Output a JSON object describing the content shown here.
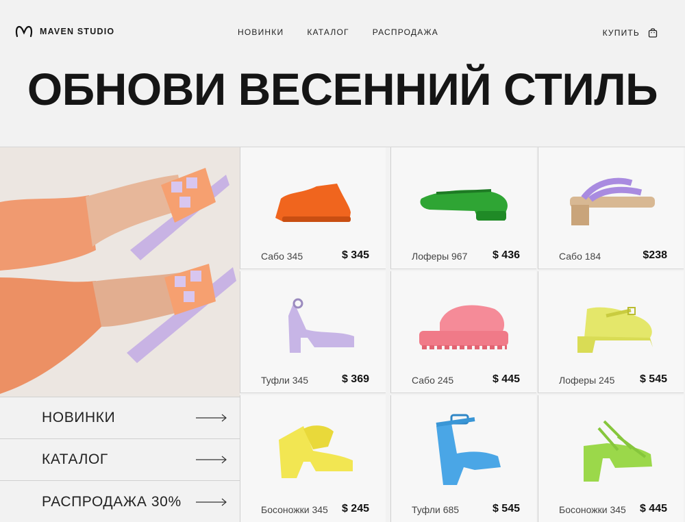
{
  "brand": {
    "name": "MAVEN STUDIO",
    "logo_icon": "infinity-loop-icon"
  },
  "nav": {
    "items": [
      {
        "label": "НОВИНКИ"
      },
      {
        "label": "КАТАЛОГ"
      },
      {
        "label": "РАСПРОДАЖА"
      }
    ]
  },
  "cart": {
    "label": "КУПИТЬ",
    "icon": "shopping-bag-icon"
  },
  "hero": {
    "title": "ОБНОВИ ВЕСЕННИЙ СТИЛЬ"
  },
  "side_links": [
    {
      "label": "НОВИНКИ",
      "icon": "arrow-right-icon"
    },
    {
      "label": "КАТАЛОГ",
      "icon": "arrow-right-icon"
    },
    {
      "label": "РАСПРОДАЖА 30%",
      "icon": "arrow-right-icon"
    }
  ],
  "products": [
    {
      "name": "Сабо 345",
      "price": "$ 345",
      "color": "#f0651e"
    },
    {
      "name": "Лоферы 967",
      "price": "$ 436",
      "color": "#2fa534"
    },
    {
      "name": "Сабо 184",
      "price": "$238",
      "color": "#a98be0"
    },
    {
      "name": "Туфли 345",
      "price": "$ 369",
      "color": "#c7b5e6"
    },
    {
      "name": "Сабо 245",
      "price": "$ 445",
      "color": "#f58b98"
    },
    {
      "name": "Лоферы 245",
      "price": "$ 545",
      "color": "#e4e76a"
    },
    {
      "name": "Босоножки 345",
      "price": "$ 245",
      "color": "#f2e652"
    },
    {
      "name": "Туфли 685",
      "price": "$ 545",
      "color": "#4aa6e6"
    },
    {
      "name": "Босоножки 345",
      "price": "$ 445",
      "color": "#9bd84a"
    }
  ]
}
